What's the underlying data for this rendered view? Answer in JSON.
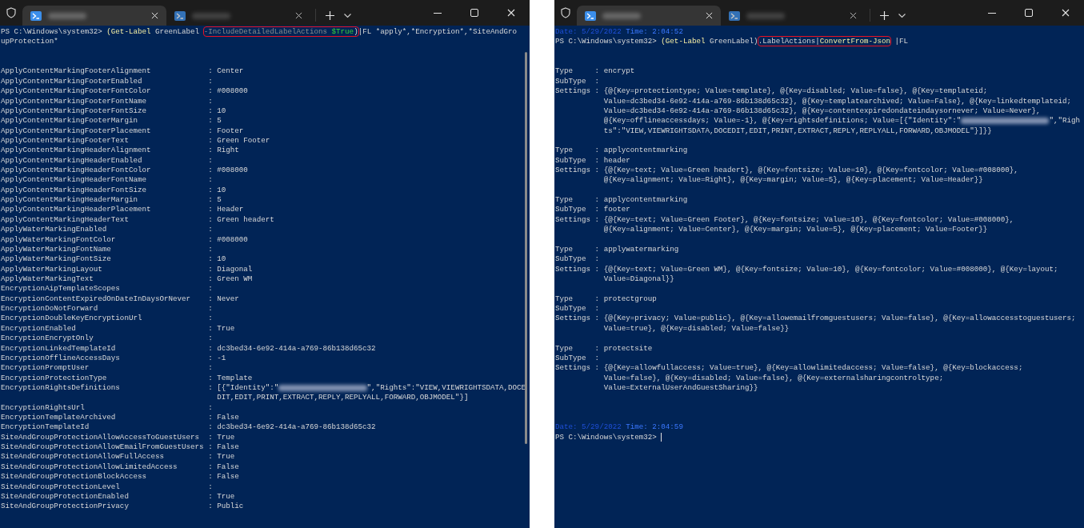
{
  "windows": [
    {
      "tabs": [
        {
          "selected": true
        },
        {
          "selected": false
        }
      ],
      "scrollbar": true,
      "console": [
        {
          "kind": "command",
          "prompt": "PS C:\\Windows\\system32>",
          "tokens": [
            {
              "text": "(Get-Label",
              "kind": "command",
              "outlined": false
            },
            {
              "text": " GreenLabel ",
              "kind": "plain",
              "outlined": false
            },
            {
              "text": "-IncludeDetailedLabelActions",
              "kind": "parameter",
              "outlined": true
            },
            {
              "text": " $True",
              "kind": "variable",
              "outlined": true
            },
            {
              "text": ")",
              "kind": "plain",
              "outlined": true
            },
            {
              "text": "|FL *apply*,*Encryption*,*SiteAndGroupProtection*",
              "kind": "plain",
              "outlined": false
            }
          ]
        },
        {
          "kind": "blank"
        },
        {
          "kind": "blank"
        },
        {
          "kind": "fields",
          "separator": ":",
          "rows": [
            {
              "key": "ApplyContentMarkingFooterAlignment",
              "value": "Center"
            },
            {
              "key": "ApplyContentMarkingFooterEnabled"
            },
            {
              "key": "ApplyContentMarkingFooterFontColor",
              "value": "#008000"
            },
            {
              "key": "ApplyContentMarkingFooterFontName"
            },
            {
              "key": "ApplyContentMarkingFooterFontSize",
              "value": "10"
            },
            {
              "key": "ApplyContentMarkingFooterMargin",
              "value": "5"
            },
            {
              "key": "ApplyContentMarkingFooterPlacement",
              "value": "Footer"
            },
            {
              "key": "ApplyContentMarkingFooterText",
              "value": "Green Footer"
            },
            {
              "key": "ApplyContentMarkingHeaderAlignment",
              "value": "Right"
            },
            {
              "key": "ApplyContentMarkingHeaderEnabled"
            },
            {
              "key": "ApplyContentMarkingHeaderFontColor",
              "value": "#008000"
            },
            {
              "key": "ApplyContentMarkingHeaderFontName"
            },
            {
              "key": "ApplyContentMarkingHeaderFontSize",
              "value": "10"
            },
            {
              "key": "ApplyContentMarkingHeaderMargin",
              "value": "5"
            },
            {
              "key": "ApplyContentMarkingHeaderPlacement",
              "value": "Header"
            },
            {
              "key": "ApplyContentMarkingHeaderText",
              "value": "Green headert"
            },
            {
              "key": "ApplyWaterMarkingEnabled"
            },
            {
              "key": "ApplyWaterMarkingFontColor",
              "value": "#008000"
            },
            {
              "key": "ApplyWaterMarkingFontName"
            },
            {
              "key": "ApplyWaterMarkingFontSize",
              "value": "10"
            },
            {
              "key": "ApplyWaterMarkingLayout",
              "value": "Diagonal"
            },
            {
              "key": "ApplyWaterMarkingText",
              "value": "Green WM"
            },
            {
              "key": "EncryptionAipTemplateScopes"
            },
            {
              "key": "EncryptionContentExpiredOnDateInDaysOrNever",
              "value": "Never"
            },
            {
              "key": "EncryptionDoNotForward"
            },
            {
              "key": "EncryptionDoubleKeyEncryptionUrl"
            },
            {
              "key": "EncryptionEnabled",
              "value": "True"
            },
            {
              "key": "EncryptionEncryptOnly"
            },
            {
              "key": "EncryptionLinkedTemplateId",
              "value": "dc3bed34-6e92-414a-a769-86b138d65c32"
            },
            {
              "key": "EncryptionOfflineAccessDays",
              "value": "-1"
            },
            {
              "key": "EncryptionPromptUser"
            },
            {
              "key": "EncryptionProtectionType",
              "value": "Template"
            },
            {
              "key": "EncryptionRightsDefinitions",
              "value_lines": [
                {
                  "parts": [
                    "[{\"Identity\":\"",
                    "\",\"Rights\":\"VIEW,VIEWRIGHTSDATA,DOCE"
                  ],
                  "redacted": true
                },
                "DIT,EDIT,PRINT,EXTRACT,REPLY,REPLYALL,FORWARD,OBJMODEL\"}]"
              ]
            },
            {
              "key": "EncryptionRightsUrl"
            },
            {
              "key": "EncryptionTemplateArchived",
              "value": "False"
            },
            {
              "key": "EncryptionTemplateId",
              "value": "dc3bed34-6e92-414a-a769-86b138d65c32"
            },
            {
              "key": "SiteAndGroupProtectionAllowAccessToGuestUsers",
              "value": "True"
            },
            {
              "key": "SiteAndGroupProtectionAllowEmailFromGuestUsers",
              "value": "False"
            },
            {
              "key": "SiteAndGroupProtectionAllowFullAccess",
              "value": "True"
            },
            {
              "key": "SiteAndGroupProtectionAllowLimitedAccess",
              "value": "False"
            },
            {
              "key": "SiteAndGroupProtectionBlockAccess",
              "value": "False"
            },
            {
              "key": "SiteAndGroupProtectionLevel"
            },
            {
              "key": "SiteAndGroupProtectionEnabled",
              "value": "True"
            },
            {
              "key": "SiteAndGroupProtectionPrivacy",
              "value": "Public"
            }
          ]
        }
      ]
    },
    {
      "tabs": [
        {
          "selected": true
        },
        {
          "selected": false
        }
      ],
      "scrollbar": false,
      "console": [
        {
          "kind": "timestamp",
          "date": "Date: 5/29/2022",
          "time": "Time: 2:04:52"
        },
        {
          "kind": "command",
          "prompt": "PS C:\\Windows\\system32>",
          "tokens": [
            {
              "text": "(Get-Label",
              "kind": "command",
              "outlined": false
            },
            {
              "text": " GreenLabel)",
              "kind": "plain",
              "outlined": false
            },
            {
              "text": ".LabelActions|",
              "kind": "plain",
              "outlined": true
            },
            {
              "text": "ConvertFrom-Json",
              "kind": "command",
              "outlined": true
            },
            {
              "text": " |FL",
              "kind": "plain",
              "outlined": false
            }
          ]
        },
        {
          "kind": "blank"
        },
        {
          "kind": "blank"
        },
        {
          "kind": "fields",
          "separator": ":",
          "rows": [
            {
              "key": "Type",
              "value": "encrypt"
            },
            {
              "key": "SubType"
            },
            {
              "key": "Settings",
              "value_lines": [
                "{@{Key=protectiontype; Value=template}, @{Key=disabled; Value=false}, @{Key=templateid;",
                "Value=dc3bed34-6e92-414a-a769-86b138d65c32}, @{Key=templatearchived; Value=False}, @{Key=linkedtemplateid;",
                "Value=dc3bed34-6e92-414a-a769-86b138d65c32}, @{Key=contentexpiredondateindaysornever; Value=Never},",
                {
                  "parts": [
                    "@{Key=offlineaccessdays; Value=-1}, @{Key=rightsdefinitions; Value=[{\"Identity\":\"",
                    "\",\"Righ"
                  ],
                  "redacted": true
                },
                "ts\":\"VIEW,VIEWRIGHTSDATA,DOCEDIT,EDIT,PRINT,EXTRACT,REPLY,REPLYALL,FORWARD,OBJMODEL\"}]}}"
              ]
            }
          ]
        },
        {
          "kind": "blank"
        },
        {
          "kind": "fields",
          "separator": ":",
          "rows": [
            {
              "key": "Type",
              "value": "applycontentmarking"
            },
            {
              "key": "SubType",
              "value": "header"
            },
            {
              "key": "Settings",
              "value_lines": [
                "{@{Key=text; Value=Green headert}, @{Key=fontsize; Value=10}, @{Key=fontcolor; Value=#008000},",
                "@{Key=alignment; Value=Right}, @{Key=margin; Value=5}, @{Key=placement; Value=Header}}"
              ]
            }
          ]
        },
        {
          "kind": "blank"
        },
        {
          "kind": "fields",
          "separator": ":",
          "rows": [
            {
              "key": "Type",
              "value": "applycontentmarking"
            },
            {
              "key": "SubType",
              "value": "footer"
            },
            {
              "key": "Settings",
              "value_lines": [
                "{@{Key=text; Value=Green Footer}, @{Key=fontsize; Value=10}, @{Key=fontcolor; Value=#008000},",
                "@{Key=alignment; Value=Center}, @{Key=margin; Value=5}, @{Key=placement; Value=Footer}}"
              ]
            }
          ]
        },
        {
          "kind": "blank"
        },
        {
          "kind": "fields",
          "separator": ":",
          "rows": [
            {
              "key": "Type",
              "value": "applywatermarking"
            },
            {
              "key": "SubType"
            },
            {
              "key": "Settings",
              "value_lines": [
                "{@{Key=text; Value=Green WM}, @{Key=fontsize; Value=10}, @{Key=fontcolor; Value=#008000}, @{Key=layout;",
                "Value=Diagonal}}"
              ]
            }
          ]
        },
        {
          "kind": "blank"
        },
        {
          "kind": "fields",
          "separator": ":",
          "rows": [
            {
              "key": "Type",
              "value": "protectgroup"
            },
            {
              "key": "SubType"
            },
            {
              "key": "Settings",
              "value_lines": [
                "{@{Key=privacy; Value=public}, @{Key=allowemailfromguestusers; Value=false}, @{Key=allowaccesstoguestusers;",
                "Value=true}, @{Key=disabled; Value=false}}"
              ]
            }
          ]
        },
        {
          "kind": "blank"
        },
        {
          "kind": "fields",
          "separator": ":",
          "rows": [
            {
              "key": "Type",
              "value": "protectsite"
            },
            {
              "key": "SubType"
            },
            {
              "key": "Settings",
              "value_lines": [
                "{@{Key=allowfullaccess; Value=true}, @{Key=allowlimitedaccess; Value=false}, @{Key=blockaccess;",
                "Value=false}, @{Key=disabled; Value=false}, @{Key=externalsharingcontroltype;",
                "Value=ExternalUserAndGuestSharing}}"
              ]
            }
          ]
        },
        {
          "kind": "blank"
        },
        {
          "kind": "blank"
        },
        {
          "kind": "blank"
        },
        {
          "kind": "timestamp",
          "date": "Date: 5/29/2022",
          "time": "Time: 2:04:59"
        },
        {
          "kind": "prompt",
          "prompt": "PS C:\\Windows\\system32>",
          "cursor": true
        }
      ]
    }
  ]
}
